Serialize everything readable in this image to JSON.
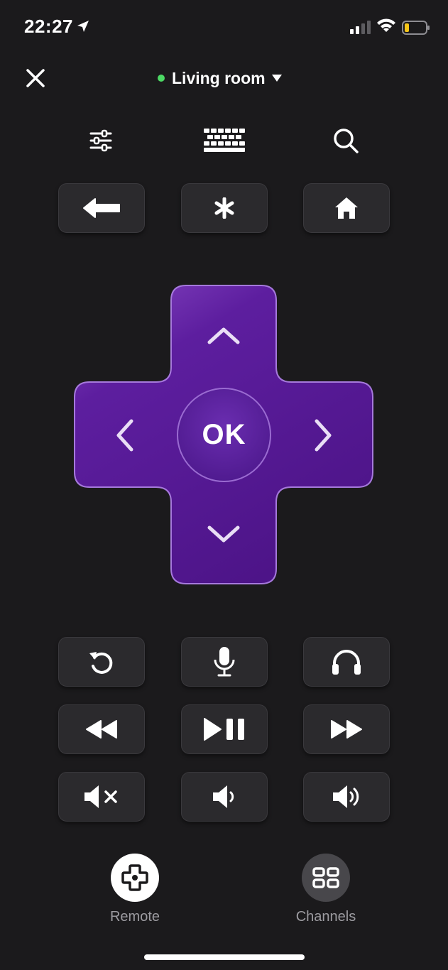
{
  "status_bar": {
    "time": "22:27",
    "icons": [
      "location-arrow-icon",
      "cellular-signal-icon",
      "wifi-icon",
      "battery-low-icon"
    ],
    "battery_color": "#f5c518"
  },
  "header": {
    "close_icon": "close-icon",
    "device_name": "Living room",
    "device_status_color": "#4cd964",
    "dropdown_icon": "caret-down-icon"
  },
  "top_icons": [
    "settings-sliders-icon",
    "keyboard-icon",
    "search-icon"
  ],
  "nav_keys": [
    "back-arrow-icon",
    "asterisk-icon",
    "home-icon"
  ],
  "dpad": {
    "ok_label": "OK",
    "accent_color": "#5a1e9c",
    "directions": [
      "up",
      "down",
      "left",
      "right"
    ]
  },
  "media_keys": [
    [
      "replay-icon",
      "microphone-icon",
      "headphones-icon"
    ],
    [
      "rewind-icon",
      "play-pause-icon",
      "fast-forward-icon"
    ],
    [
      "mute-icon",
      "volume-down-icon",
      "volume-up-icon"
    ]
  ],
  "bottom_nav": {
    "remote_label": "Remote",
    "channels_label": "Channels",
    "active": "Remote"
  }
}
